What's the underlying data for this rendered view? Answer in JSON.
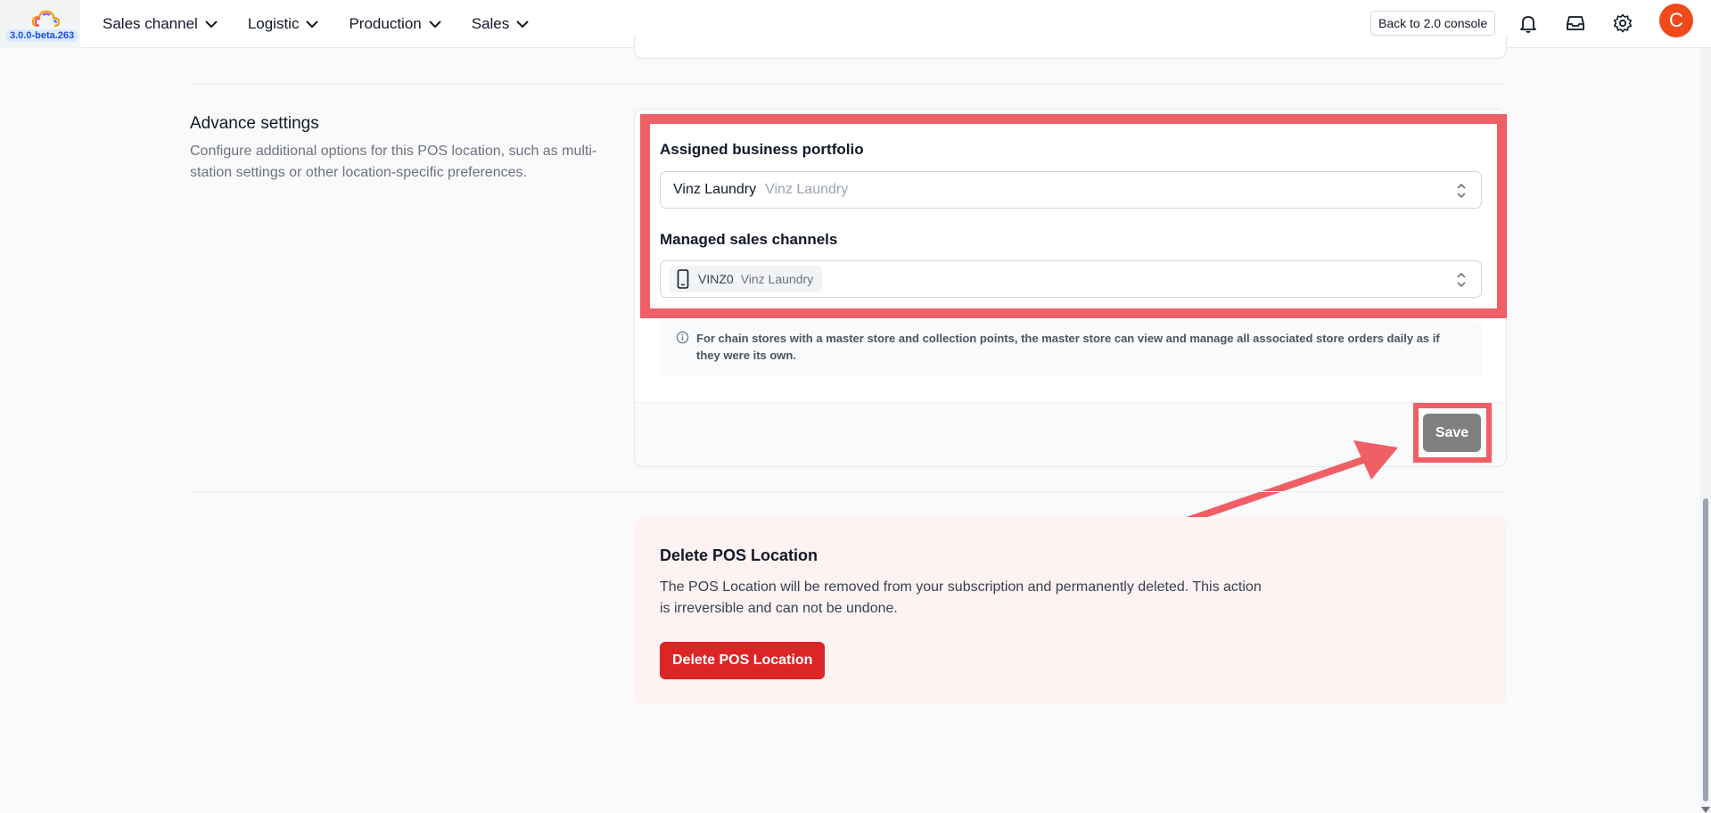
{
  "header": {
    "version": "3.0.0-beta.263",
    "nav": [
      {
        "label": "Sales channel"
      },
      {
        "label": "Logistic"
      },
      {
        "label": "Production"
      },
      {
        "label": "Sales"
      }
    ],
    "back_button": "Back to 2.0 console",
    "avatar_initial": "C"
  },
  "advance": {
    "title": "Advance settings",
    "description": "Configure additional options for this POS location, such as multi-station settings or other location-specific preferences.",
    "portfolio_label": "Assigned business portfolio",
    "portfolio_value": "Vinz Laundry",
    "portfolio_sub": "Vinz Laundry",
    "channels_label": "Managed sales channels",
    "channel_code": "VINZ0",
    "channel_name": "Vinz Laundry",
    "info": "For chain stores with a master store and collection points, the master store can view and manage all associated store orders daily as if they were its own.",
    "save_label": "Save"
  },
  "delete": {
    "title": "Delete POS Location",
    "description": "The POS Location will be removed from your subscription and permanently deleted. This action is irreversible and can not be undone.",
    "button": "Delete POS Location"
  },
  "colors": {
    "highlight": "#ef5f65",
    "danger": "#dc2626",
    "avatar": "#f04a1a"
  }
}
